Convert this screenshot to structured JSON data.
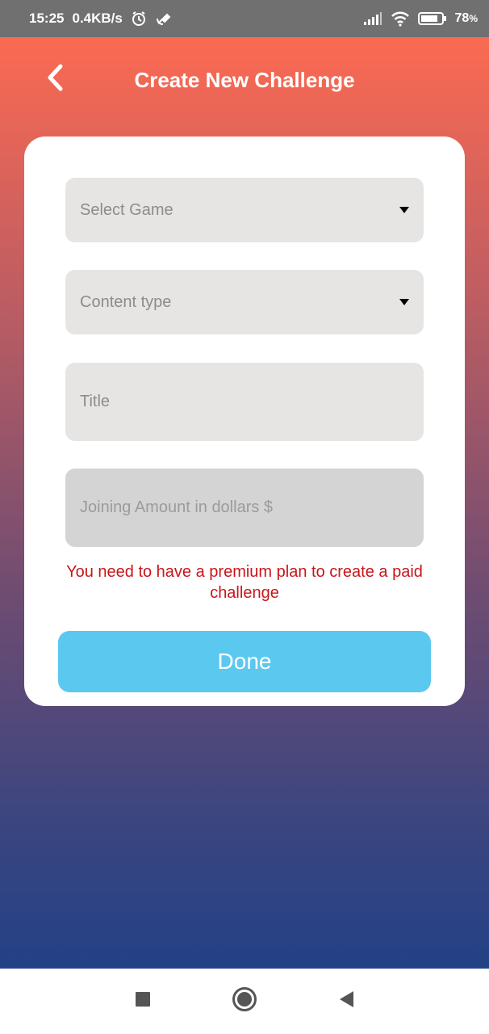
{
  "status_bar": {
    "time": "15:25",
    "net_speed": "0.4KB/s",
    "battery_percent": "78",
    "battery_unit": "%",
    "icons": [
      "alarm-icon",
      "satellite-icon",
      "signal-icon",
      "wifi-icon",
      "battery-icon"
    ]
  },
  "header": {
    "title": "Create New Challenge",
    "back_icon": "chevron-left-icon"
  },
  "form": {
    "select_game": {
      "placeholder": "Select Game",
      "icon": "dropdown-caret-icon"
    },
    "content_type": {
      "placeholder": "Content type",
      "icon": "dropdown-caret-icon"
    },
    "title": {
      "placeholder": "Title"
    },
    "joining_amount": {
      "placeholder": "Joining Amount in dollars $"
    },
    "warning": "You need to have a premium plan to create a paid challenge",
    "done_label": "Done"
  },
  "nav_bar": {
    "icons": [
      "recents-square-icon",
      "home-circle-icon",
      "back-triangle-icon"
    ]
  },
  "colors": {
    "gradient_top": "#fb6a52",
    "gradient_bottom": "#234186",
    "done_button": "#5bc8f0",
    "warning_text": "#c8161b",
    "field_bg": "#e7e4e4",
    "field_disabled_bg": "#d4d4d4"
  }
}
